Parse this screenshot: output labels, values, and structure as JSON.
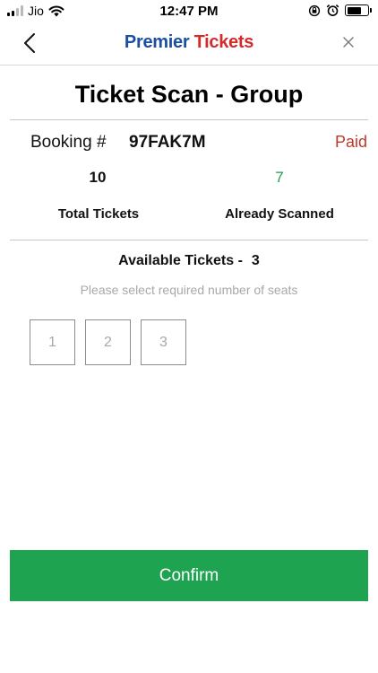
{
  "status_bar": {
    "carrier": "Jio",
    "time": "12:47 PM",
    "signal_bars": 4,
    "signal_active": 2,
    "battery_level": 0.72,
    "icons": [
      "signal-icon",
      "wifi-icon",
      "orientation-lock-icon",
      "alarm-icon",
      "battery-icon"
    ]
  },
  "header": {
    "brand_primary": "Premier",
    "brand_secondary": "Tickets",
    "back_icon": "chevron-left-icon",
    "close_icon": "close-icon",
    "colors": {
      "brand_primary": "#1c4fa0",
      "brand_secondary": "#d42a2a"
    }
  },
  "page": {
    "title": "Ticket Scan - Group"
  },
  "booking": {
    "label": "Booking #",
    "id": "97FAK7M",
    "status": "Paid",
    "status_color": "#c0392b"
  },
  "stats": {
    "total_value": "10",
    "total_label": "Total Tickets",
    "scanned_value": "7",
    "scanned_label": "Already Scanned",
    "scanned_color": "#1e9e4a"
  },
  "availability": {
    "label": "Available Tickets -",
    "count": "3",
    "hint": "Please select required number of seats"
  },
  "seats": [
    {
      "label": "1"
    },
    {
      "label": "2"
    },
    {
      "label": "3"
    }
  ],
  "actions": {
    "confirm_label": "Confirm",
    "confirm_color": "#1ea351"
  }
}
